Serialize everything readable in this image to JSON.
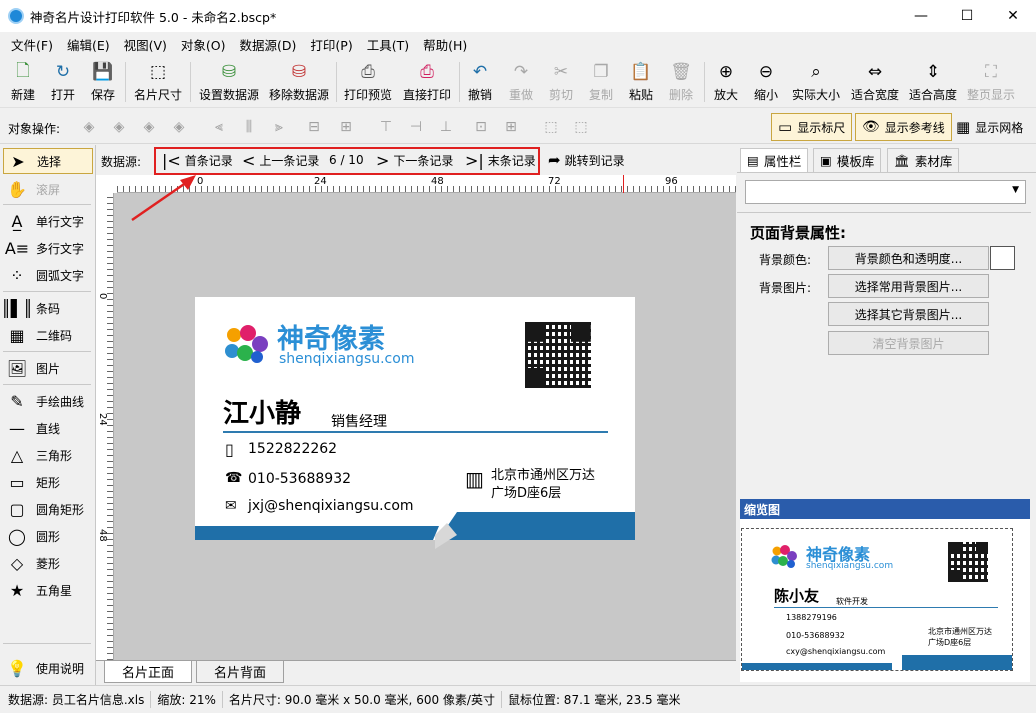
{
  "window": {
    "title": "神奇名片设计打印软件 5.0 - 未命名2.bscp*",
    "minimize": "—",
    "maximize": "☐",
    "close": "✕"
  },
  "menu": [
    "文件(F)",
    "编辑(E)",
    "视图(V)",
    "对象(O)",
    "数据源(D)",
    "打印(P)",
    "工具(T)",
    "帮助(H)"
  ],
  "toolbar": {
    "new": "新建",
    "open": "打开",
    "save": "保存",
    "card_size": "名片尺寸",
    "set_datasource": "设置数据源",
    "remove_datasource": "移除数据源",
    "print_preview": "打印预览",
    "direct_print": "直接打印",
    "undo": "撤销",
    "redo": "重做",
    "cut": "剪切",
    "copy": "复制",
    "paste": "粘贴",
    "delete": "删除",
    "zoom_in": "放大",
    "zoom_out": "缩小",
    "actual_size": "实际大小",
    "fit_width": "适合宽度",
    "fit_height": "适合高度",
    "full_page": "整页显示"
  },
  "objbar": {
    "label": "对象操作:",
    "show_ruler": "显示标尺",
    "show_guides": "显示参考线",
    "show_grid": "显示网格"
  },
  "tools": {
    "select": "选择",
    "scroll": "滚屏",
    "single_text": "单行文字",
    "multi_text": "多行文字",
    "arc_text": "圆弧文字",
    "barcode": "条码",
    "qrcode": "二维码",
    "image": "图片",
    "freehand": "手绘曲线",
    "line": "直线",
    "triangle": "三角形",
    "rect": "矩形",
    "round_rect": "圆角矩形",
    "ellipse": "圆形",
    "diamond": "菱形",
    "star": "五角星",
    "help": "使用说明"
  },
  "record": {
    "label": "数据源:",
    "first": "首条记录",
    "prev": "上一条记录",
    "counter": "6 / 10",
    "next": "下一条记录",
    "last": "末条记录",
    "jump": "跳转到记录"
  },
  "ruler": {
    "h": [
      "0",
      "24",
      "48",
      "72",
      "96"
    ],
    "v": [
      "0",
      "24",
      "48"
    ]
  },
  "card": {
    "brand": "神奇像素",
    "site": "shenqixiangsu.com",
    "name": "江小静",
    "job": "销售经理",
    "mobile": "1522822262",
    "phone": "010-53688932",
    "email": "jxj@shenqixiangsu.com",
    "address_line1": "北京市通州区万达",
    "address_line2": "广场D座6层",
    "colors": {
      "brand_blue": "#2b8fd6",
      "band": "#1f6fa8"
    }
  },
  "tabs": {
    "front": "名片正面",
    "back": "名片背面"
  },
  "panel": {
    "tab_props": "属性栏",
    "tab_templates": "模板库",
    "tab_materials": "素材库",
    "section_title": "页面背景属性:",
    "bg_color_label": "背景颜色:",
    "bg_color_btn": "背景颜色和透明度...",
    "bg_image_label": "背景图片:",
    "bg_common_btn": "选择常用背景图片...",
    "bg_other_btn": "选择其它背景图片...",
    "bg_clear_btn": "清空背景图片",
    "preview_title": "缩览图"
  },
  "preview": {
    "brand": "神奇像素",
    "site": "shenqixiangsu.com",
    "name": "陈小友",
    "job": "软件开发",
    "mobile": "1388279196",
    "phone": "010-53688932",
    "email": "cxy@shenqixiangsu.com",
    "address_line1": "北京市通州区万达",
    "address_line2": "广场D座6层"
  },
  "status": {
    "datasource": "数据源: 员工名片信息.xls",
    "zoom": "缩放: 21%",
    "card_size": "名片尺寸: 90.0 毫米 x 50.0 毫米, 600 像素/英寸",
    "mouse": "鼠标位置: 87.1 毫米, 23.5 毫米"
  }
}
